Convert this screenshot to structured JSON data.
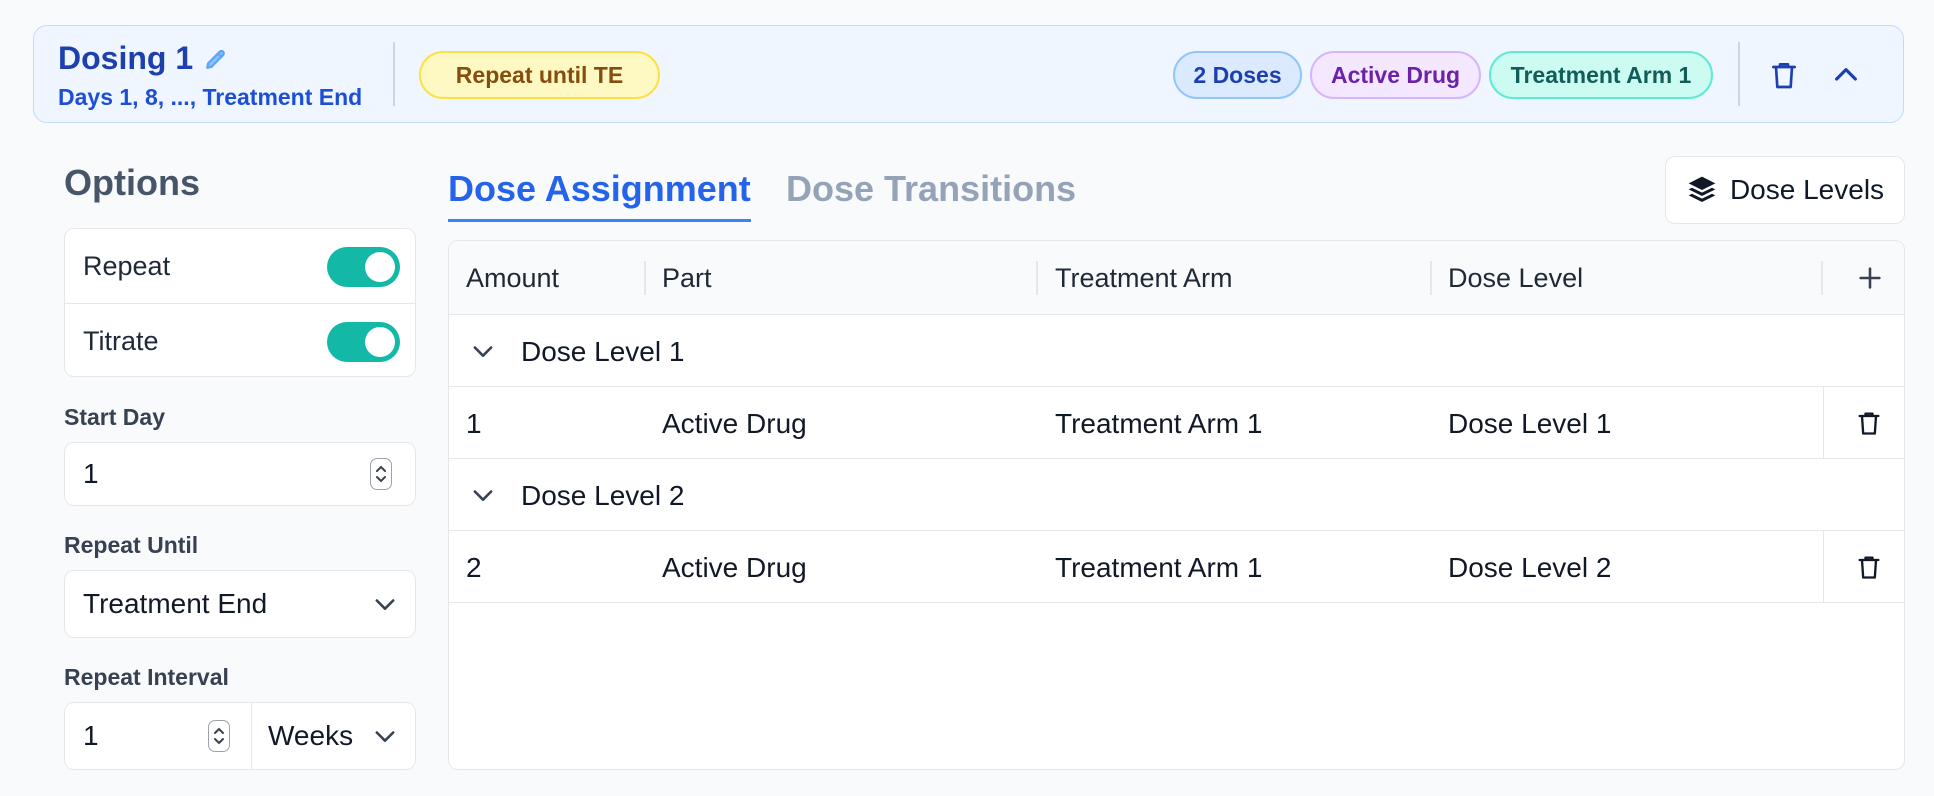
{
  "header": {
    "title": "Dosing 1",
    "subtitle": "Days 1, 8, ..., Treatment End",
    "repeat_badge": "Repeat until TE",
    "doses_badge": "2 Doses",
    "drug_badge": "Active Drug",
    "arm_badge": "Treatment Arm 1",
    "icons": [
      "pencil-icon",
      "trash-icon",
      "chevron-up-icon"
    ]
  },
  "options": {
    "title": "Options",
    "repeat_label": "Repeat",
    "repeat_on": true,
    "titrate_label": "Titrate",
    "titrate_on": true
  },
  "start_day": {
    "label": "Start Day",
    "value": "1"
  },
  "repeat_until": {
    "label": "Repeat Until",
    "value": "Treatment End"
  },
  "repeat_interval": {
    "label": "Repeat Interval",
    "value": "1",
    "unit": "Weeks"
  },
  "tabs": {
    "active": "Dose Assignment",
    "inactive": "Dose Transitions"
  },
  "dose_levels_button": "Dose Levels",
  "table": {
    "columns": [
      "Amount",
      "Part",
      "Treatment Arm",
      "Dose Level"
    ],
    "groups": [
      {
        "label": "Dose Level 1",
        "rows": [
          {
            "amount": "1",
            "part": "Active Drug",
            "arm": "Treatment Arm 1",
            "level": "Dose Level 1"
          }
        ]
      },
      {
        "label": "Dose Level 2",
        "rows": [
          {
            "amount": "2",
            "part": "Active Drug",
            "arm": "Treatment Arm 1",
            "level": "Dose Level 2"
          }
        ]
      }
    ]
  },
  "colors": {
    "accent": "#2563eb",
    "toggle_on": "#14b8a6",
    "header_bg": "#eff6ff"
  }
}
